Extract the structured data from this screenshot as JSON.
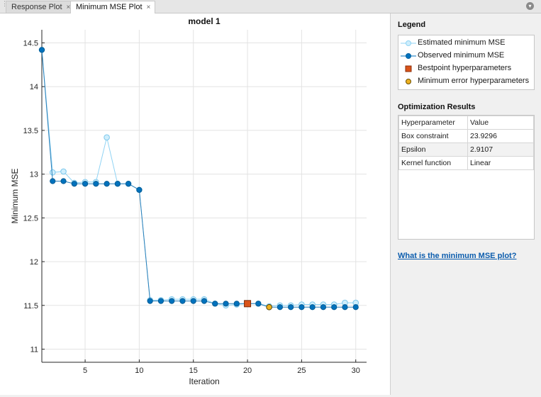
{
  "tabs": [
    {
      "label": "Response Plot",
      "close": "×",
      "active": false
    },
    {
      "label": "Minimum MSE Plot",
      "close": "×",
      "active": true
    }
  ],
  "legend": {
    "title": "Legend",
    "items": [
      {
        "label": "Estimated minimum MSE",
        "marker": "circle-open",
        "color": "#8fd3f4"
      },
      {
        "label": "Observed minimum MSE",
        "marker": "circle-filled",
        "color": "#0072bd"
      },
      {
        "label": "Bestpoint hyperparameters",
        "marker": "square",
        "color": "#d95319"
      },
      {
        "label": "Minimum error hyperparameters",
        "marker": "circle",
        "color": "#edb120"
      }
    ]
  },
  "results": {
    "title": "Optimization Results",
    "headers": [
      "Hyperparameter",
      "Value"
    ],
    "rows": [
      [
        "Box constraint",
        "23.9296"
      ],
      [
        "Epsilon",
        "2.9107"
      ],
      [
        "Kernel function",
        "Linear"
      ]
    ]
  },
  "help_link": "What is the minimum MSE plot?",
  "chart_data": {
    "type": "line",
    "title": "model 1",
    "xlabel": "Iteration",
    "ylabel": "Minimum MSE",
    "xlim": [
      1,
      31
    ],
    "ylim": [
      10.85,
      14.65
    ],
    "xticks": [
      5,
      10,
      15,
      20,
      25,
      30
    ],
    "yticks": [
      11,
      11.5,
      12,
      12.5,
      13,
      13.5,
      14,
      14.5
    ],
    "grid": true,
    "series": [
      {
        "name": "Estimated minimum MSE",
        "color": "#8fd3f4",
        "x": [
          1,
          2,
          3,
          4,
          5,
          6,
          7,
          8,
          9,
          10,
          11,
          12,
          13,
          14,
          15,
          16,
          17,
          18,
          19,
          20,
          21,
          22,
          23,
          24,
          25,
          26,
          27,
          28,
          29,
          30
        ],
        "values": [
          14.42,
          13.02,
          13.03,
          12.9,
          12.91,
          12.91,
          13.42,
          12.89,
          12.89,
          12.82,
          11.56,
          11.56,
          11.57,
          11.57,
          11.57,
          11.57,
          11.52,
          11.5,
          11.51,
          11.52,
          11.52,
          11.49,
          11.5,
          11.5,
          11.51,
          11.51,
          11.51,
          11.51,
          11.53,
          11.53
        ]
      },
      {
        "name": "Observed minimum MSE",
        "color": "#0072bd",
        "x": [
          1,
          2,
          3,
          4,
          5,
          6,
          7,
          8,
          9,
          10,
          11,
          12,
          13,
          14,
          15,
          16,
          17,
          18,
          19,
          20,
          21,
          22,
          23,
          24,
          25,
          26,
          27,
          28,
          29,
          30
        ],
        "values": [
          14.42,
          12.92,
          12.92,
          12.89,
          12.89,
          12.89,
          12.89,
          12.89,
          12.89,
          12.82,
          11.55,
          11.55,
          11.55,
          11.55,
          11.55,
          11.55,
          11.52,
          11.52,
          11.52,
          11.52,
          11.52,
          11.48,
          11.48,
          11.48,
          11.48,
          11.48,
          11.48,
          11.48,
          11.48,
          11.48
        ]
      }
    ],
    "bestpoint": {
      "name": "Bestpoint hyperparameters",
      "x": 20,
      "y": 11.52,
      "color": "#d95319"
    },
    "min_error": {
      "name": "Minimum error hyperparameters",
      "x": 22,
      "y": 11.48,
      "color": "#edb120"
    }
  }
}
